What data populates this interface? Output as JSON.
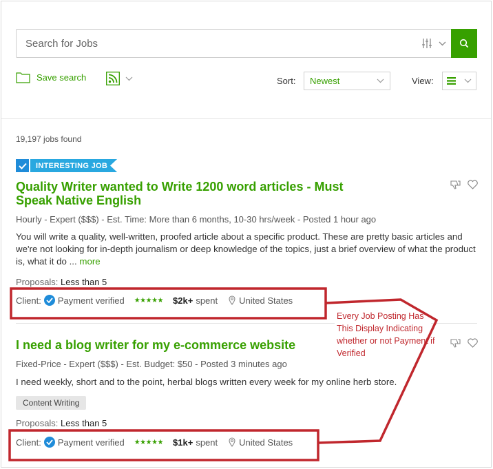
{
  "search": {
    "placeholder": "Search for Jobs",
    "accent_color": "#37a000",
    "search_icon": "magnifier-icon",
    "filter_icon": "sliders-icon"
  },
  "toolbar": {
    "save_search_label": "Save search",
    "sort_label": "Sort:",
    "sort_value": "Newest",
    "view_label": "View:",
    "view_icon": "list-icon"
  },
  "results": {
    "count_text": "19,197 jobs found"
  },
  "jobs": [
    {
      "badge": "INTERESTING JOB",
      "title": "Quality Writer wanted to Write 1200 word articles - Must Speak Native English",
      "meta_type": "Hourly",
      "meta_rest": " - Expert ($$$) - Est. Time: More than 6 months, 10-30 hrs/week - Posted 1 hour ago",
      "description": "You will write a quality, well-written, proofed article about a specific product. These are pretty basic articles and we're not looking for in-depth journalism or deep knowledge of the topics, just a brief overview of what the product is, what it do ... ",
      "more_label": "more",
      "proposals_label": "Proposals:",
      "proposals_value": "Less than 5",
      "client_label": "Client:",
      "payment": "Payment verified",
      "stars": "★★★★★",
      "spent_amount": "$2k+",
      "spent_label": "spent",
      "location": "United States"
    },
    {
      "title": "I need a blog writer for my e-commerce website",
      "meta_type": "Fixed-Price",
      "meta_rest": " - Expert ($$$) - Est. Budget: $50 - Posted 3 minutes ago",
      "description": "I need weekly, short and to the point, herbal blogs written every week for my online herb store.",
      "skill": "Content Writing",
      "proposals_label": "Proposals:",
      "proposals_value": "Less than 5",
      "client_label": "Client:",
      "payment": "Payment verified",
      "stars": "★★★★★",
      "spent_amount": "$1k+",
      "spent_label": "spent",
      "location": "United States"
    }
  ],
  "annotation": {
    "text": "Every Job Posting Has This Display Indicating whether or not Payment if Verified",
    "color": "#c0272d"
  }
}
